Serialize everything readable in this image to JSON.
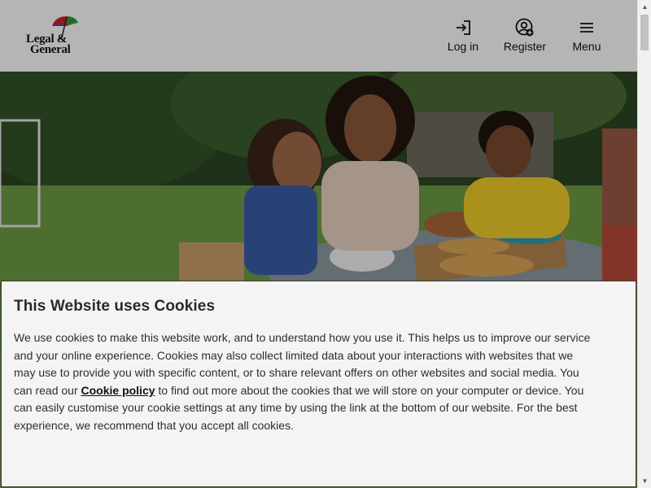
{
  "header": {
    "logo_line1": "Legal &",
    "logo_line2": "General",
    "nav": [
      {
        "label": "Log in",
        "icon": "login-icon"
      },
      {
        "label": "Register",
        "icon": "register-user-icon"
      },
      {
        "label": "Menu",
        "icon": "hamburger-menu-icon"
      }
    ]
  },
  "hero": {
    "image": "family-eating-pizza-outdoors-photo"
  },
  "cookie_banner": {
    "title": "This Website uses Cookies",
    "text_before_link": "We use cookies to make this website work, and to understand how you use it. This helps us to improve our service and your online experience. Cookies may also collect limited data about your interactions with websites that we may use to provide you with specific content, or to share relevant offers on other websites and social media. You can read our ",
    "link_label": "Cookie policy",
    "text_after_link": " to find out more about the cookies that we will store on your computer or device. You can easily customise your cookie settings at any time by using the link at the bottom of our website. For the best experience, we recommend that you accept all cookies."
  },
  "colors": {
    "umbrella_red": "#d4202a",
    "umbrella_blue": "#1e5ab4",
    "umbrella_green": "#2e9a3a",
    "umbrella_yellow": "#f2c318"
  }
}
